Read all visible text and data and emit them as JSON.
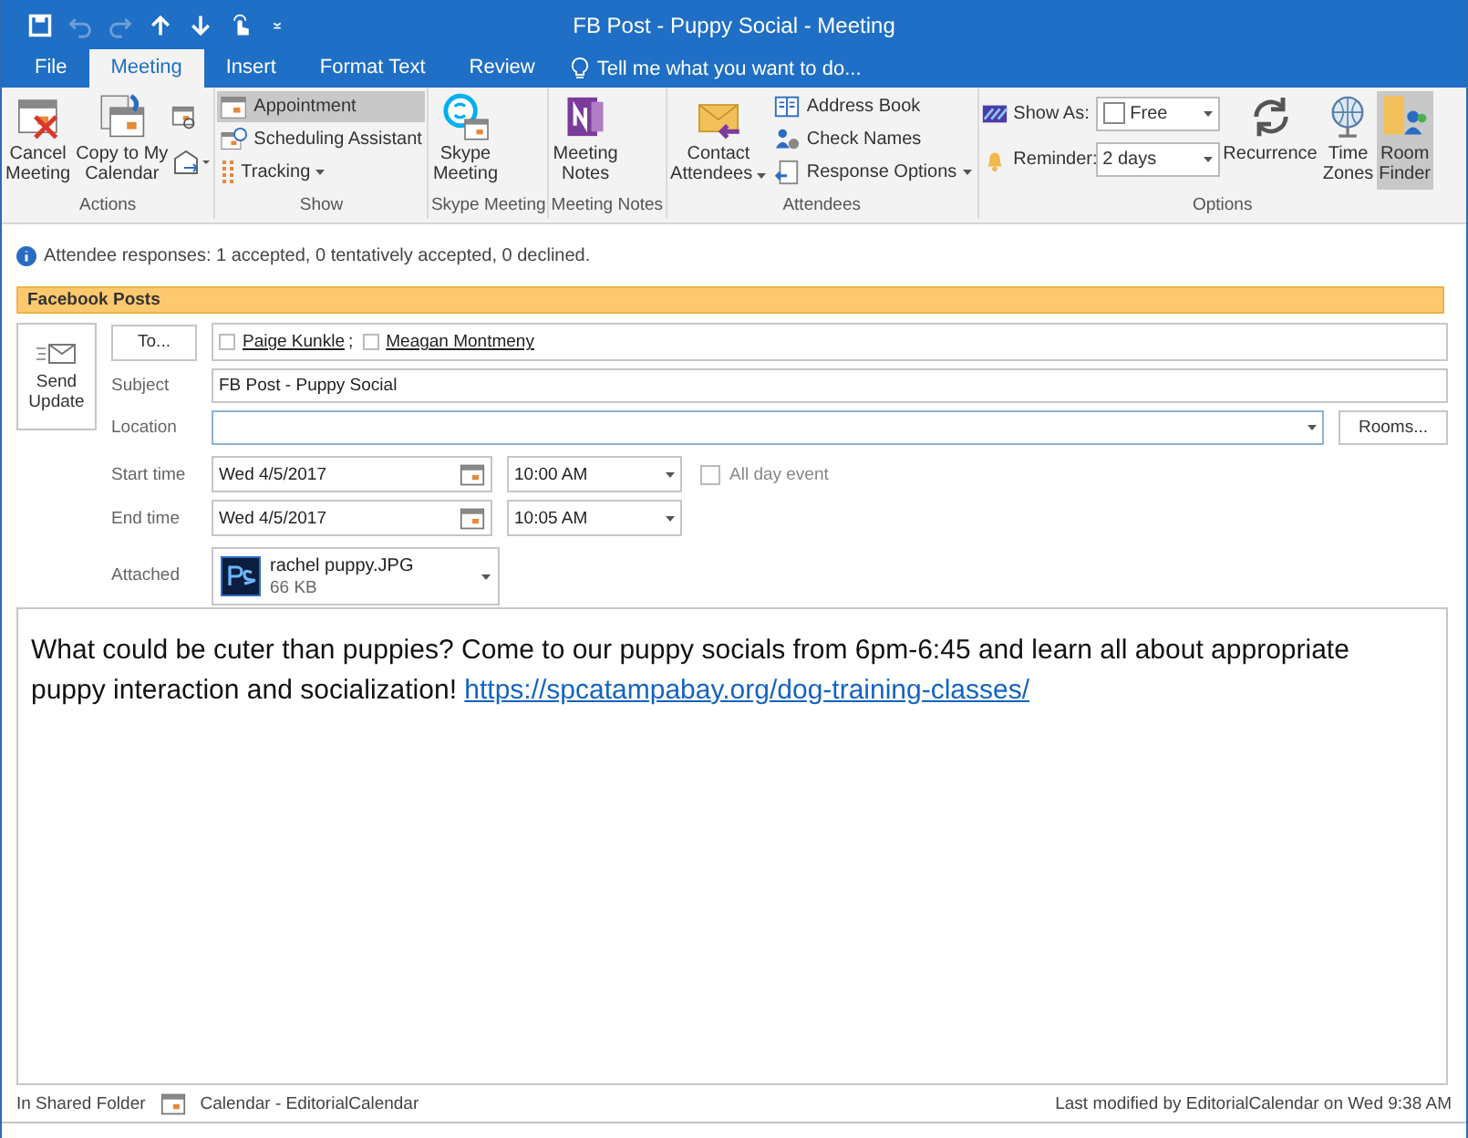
{
  "window": {
    "title": "FB Post - Puppy Social - Meeting"
  },
  "quick_access": [
    {
      "disabled": false
    },
    {
      "disabled": true
    },
    {
      "disabled": true
    },
    {
      "disabled": false
    },
    {
      "disabled": false
    },
    {
      "disabled": false
    },
    {
      "disabled": false
    }
  ],
  "tabs": [
    {
      "label": "File",
      "selected": false
    },
    {
      "label": "Meeting",
      "selected": true
    },
    {
      "label": "Insert",
      "selected": false
    },
    {
      "label": "Format Text",
      "selected": false
    },
    {
      "label": "Review",
      "selected": false
    }
  ],
  "tell_me": {
    "placeholder": "Tell me what you want to do..."
  },
  "ribbon": [
    {
      "label": "Actions",
      "items": [
        {
          "kind": "large",
          "label": "Cancel\nMeeting",
          "selected": false
        },
        {
          "kind": "large",
          "label": "Copy to My\nCalendar",
          "selected": false
        },
        {
          "kind": "icons"
        }
      ]
    },
    {
      "label": "Show",
      "items": [
        {
          "kind": "small",
          "label": "Appointment",
          "selected": true
        },
        {
          "kind": "small",
          "label": "Scheduling Assistant",
          "selected": false
        },
        {
          "kind": "small",
          "label": "Tracking",
          "dropdown": true,
          "selected": false
        }
      ]
    },
    {
      "label": "Skype Meeting",
      "items": [
        {
          "kind": "large",
          "label": "Skype\nMeeting",
          "selected": false
        }
      ]
    },
    {
      "label": "Meeting Notes",
      "items": [
        {
          "kind": "large",
          "label": "Meeting\nNotes",
          "selected": false
        }
      ]
    },
    {
      "label": "Attendees",
      "items": [
        {
          "kind": "large",
          "label": "Contact\nAttendees",
          "dropdown": true,
          "selected": false
        },
        {
          "kind": "small",
          "label": "Address Book",
          "selected": false
        },
        {
          "kind": "small",
          "label": "Check Names",
          "selected": false
        },
        {
          "kind": "small",
          "label": "Response Options",
          "dropdown": true,
          "selected": false
        }
      ]
    },
    {
      "label": "Options",
      "items": [
        {
          "kind": "combo",
          "label": "Show As:",
          "value": "Free"
        },
        {
          "kind": "combo",
          "label": "Reminder:",
          "value": "2 days"
        },
        {
          "kind": "large",
          "label": "Recurrence",
          "selected": false
        },
        {
          "kind": "large",
          "label": "Time\nZones",
          "selected": false
        },
        {
          "kind": "large",
          "label": "Room\nFinder",
          "selected": true
        }
      ]
    }
  ],
  "info": "Attendee responses: 1 accepted, 0 tentatively accepted, 0 declined.",
  "category": "Facebook Posts",
  "send_button": "Send\nUpdate",
  "to_button": "To...",
  "recipients": [
    {
      "name": "Paige Kunkle",
      "separator": ";"
    },
    {
      "name": "Meagan Montmeny"
    }
  ],
  "subject": {
    "label": "Subject",
    "value": "FB Post - Puppy Social"
  },
  "location": {
    "label": "Location",
    "rooms_button": "Rooms..."
  },
  "start_time": {
    "label": "Start time",
    "date": "Wed 4/5/2017",
    "time": "10:00 AM"
  },
  "all_day": {
    "label": "All day event",
    "checked": false
  },
  "end_time": {
    "label": "End time",
    "date": "Wed 4/5/2017",
    "time": "10:05 AM"
  },
  "attachment": {
    "label": "Attached",
    "name": "rachel puppy.JPG",
    "size": "66 KB"
  },
  "body": {
    "text": "What could be cuter than puppies? Come to our puppy socials from 6pm-6:45 and learn all about appropriate puppy interaction and socialization!",
    "link": "https://spcatampabay.org/dog-training-classes/"
  },
  "status_bar": {
    "folder_label": "In Shared Folder",
    "folder": "Calendar - EditorialCalendar",
    "modified": "Last modified by EditorialCalendar on Wed 9:38 AM"
  }
}
